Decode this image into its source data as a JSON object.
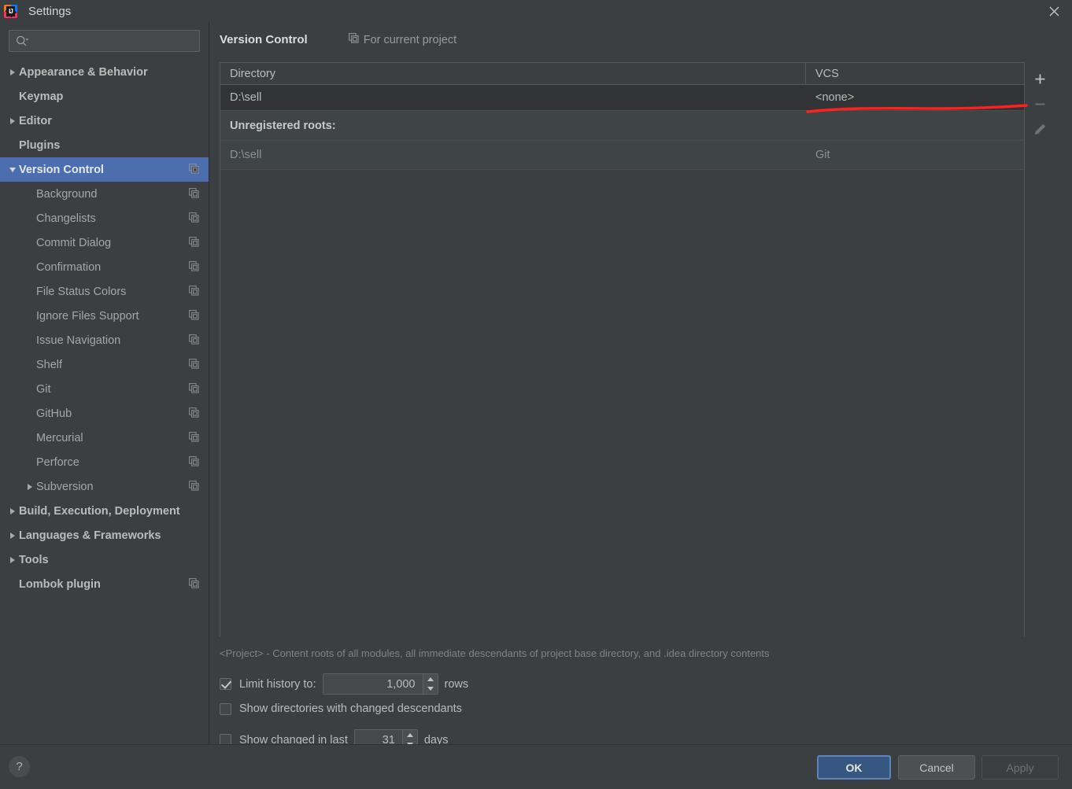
{
  "window": {
    "title": "Settings",
    "logo_icon": "intellij-idea-logo",
    "close_icon": "close-icon"
  },
  "sidebar": {
    "search": {
      "placeholder": "",
      "value": "",
      "icon": "search-icon",
      "dropdown_icon": "chevron-down-icon"
    },
    "items": [
      {
        "label": "Appearance & Behavior",
        "level": 0,
        "arrow": "right",
        "copy_icon": false,
        "selected": false
      },
      {
        "label": "Keymap",
        "level": 0,
        "arrow": "none",
        "copy_icon": false,
        "selected": false
      },
      {
        "label": "Editor",
        "level": 0,
        "arrow": "right",
        "copy_icon": false,
        "selected": false
      },
      {
        "label": "Plugins",
        "level": 0,
        "arrow": "none",
        "copy_icon": false,
        "selected": false
      },
      {
        "label": "Version Control",
        "level": 0,
        "arrow": "down",
        "copy_icon": true,
        "selected": true
      },
      {
        "label": "Background",
        "level": 1,
        "arrow": "none",
        "copy_icon": true,
        "selected": false
      },
      {
        "label": "Changelists",
        "level": 1,
        "arrow": "none",
        "copy_icon": true,
        "selected": false
      },
      {
        "label": "Commit Dialog",
        "level": 1,
        "arrow": "none",
        "copy_icon": true,
        "selected": false
      },
      {
        "label": "Confirmation",
        "level": 1,
        "arrow": "none",
        "copy_icon": true,
        "selected": false
      },
      {
        "label": "File Status Colors",
        "level": 1,
        "arrow": "none",
        "copy_icon": true,
        "selected": false
      },
      {
        "label": "Ignore Files Support",
        "level": 1,
        "arrow": "none",
        "copy_icon": true,
        "selected": false
      },
      {
        "label": "Issue Navigation",
        "level": 1,
        "arrow": "none",
        "copy_icon": true,
        "selected": false
      },
      {
        "label": "Shelf",
        "level": 1,
        "arrow": "none",
        "copy_icon": true,
        "selected": false
      },
      {
        "label": "Git",
        "level": 1,
        "arrow": "none",
        "copy_icon": true,
        "selected": false
      },
      {
        "label": "GitHub",
        "level": 1,
        "arrow": "none",
        "copy_icon": true,
        "selected": false
      },
      {
        "label": "Mercurial",
        "level": 1,
        "arrow": "none",
        "copy_icon": true,
        "selected": false
      },
      {
        "label": "Perforce",
        "level": 1,
        "arrow": "none",
        "copy_icon": true,
        "selected": false
      },
      {
        "label": "Subversion",
        "level": 1,
        "arrow": "right",
        "copy_icon": true,
        "selected": false
      },
      {
        "label": "Build, Execution, Deployment",
        "level": 0,
        "arrow": "right",
        "copy_icon": false,
        "selected": false
      },
      {
        "label": "Languages & Frameworks",
        "level": 0,
        "arrow": "right",
        "copy_icon": false,
        "selected": false
      },
      {
        "label": "Tools",
        "level": 0,
        "arrow": "right",
        "copy_icon": false,
        "selected": false
      },
      {
        "label": "Lombok plugin",
        "level": 0,
        "arrow": "none",
        "copy_icon": true,
        "selected": false
      }
    ]
  },
  "main": {
    "title": "Version Control",
    "project_scope_label": "For current project",
    "project_scope_icon": "copy-scope-icon",
    "table": {
      "columns": [
        "Directory",
        "VCS"
      ],
      "rows": [
        {
          "kind": "data",
          "directory": "D:\\sell",
          "vcs": "<none>"
        },
        {
          "kind": "group",
          "directory": "Unregistered roots:",
          "vcs": ""
        },
        {
          "kind": "unregistered",
          "directory": "D:\\sell",
          "vcs": "Git"
        }
      ]
    },
    "toolbar": {
      "add_label": "+",
      "add_icon": "plus-icon",
      "remove_icon": "minus-icon",
      "edit_icon": "pencil-icon"
    },
    "footnote": "<Project> - Content roots of all modules, all immediate descendants of project base directory, and .idea directory contents",
    "options": {
      "limit_history_label": "Limit history to:",
      "limit_history_checked": true,
      "limit_history_value": "1,000",
      "limit_history_suffix": "rows",
      "show_directories_label": "Show directories with changed descendants",
      "show_directories_checked": false,
      "show_changed_label": "Show changed in last",
      "show_changed_checked": false,
      "show_changed_value": "31",
      "show_changed_suffix": "days"
    }
  },
  "bottom": {
    "help_label": "?",
    "ok_label": "OK",
    "cancel_label": "Cancel",
    "apply_label": "Apply"
  },
  "annotation": {
    "color": "#ff2020",
    "type": "hand-drawn-underline"
  }
}
